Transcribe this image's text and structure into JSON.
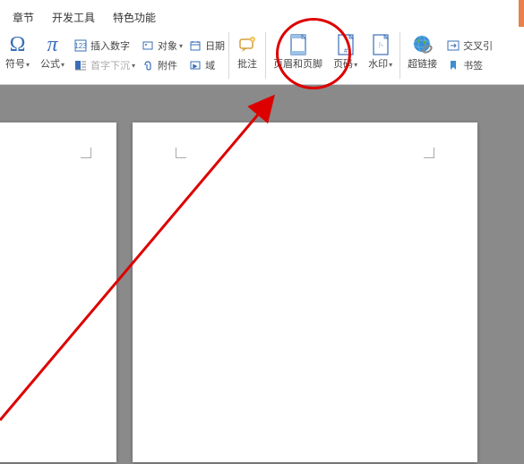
{
  "menubar": {
    "items": [
      "章节",
      "开发工具",
      "特色功能"
    ]
  },
  "ribbon": {
    "symbol": {
      "label": "符号",
      "glyph": "Ω"
    },
    "formula": {
      "label": "公式",
      "glyph": "π"
    },
    "insert_number": "插入数字",
    "first_char_sink": "首字下沉",
    "object": "对象",
    "attachment": "附件",
    "date": "日期",
    "field": "域",
    "annotation": "批注",
    "header_footer": "页眉和页脚",
    "page_number": "页码",
    "watermark": "水印",
    "hyperlink": "超链接",
    "cross_ref": "交叉引",
    "bookmark": "书签"
  }
}
